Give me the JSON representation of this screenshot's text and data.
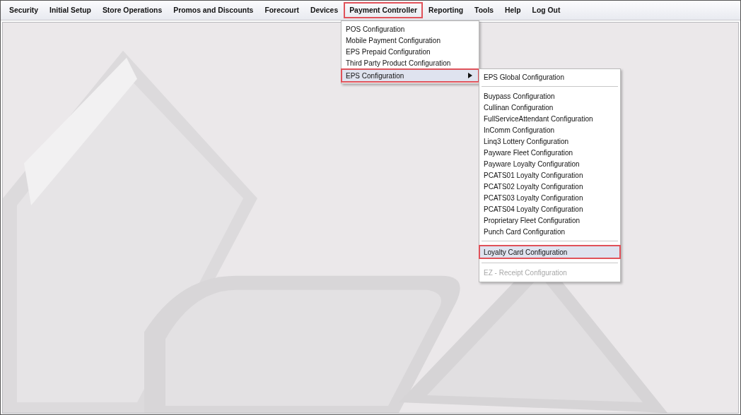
{
  "menu_bar": {
    "items": [
      {
        "label": "Security",
        "highlighted": false
      },
      {
        "label": "Initial Setup",
        "highlighted": false
      },
      {
        "label": "Store Operations",
        "highlighted": false
      },
      {
        "label": "Promos and Discounts",
        "highlighted": false
      },
      {
        "label": "Forecourt",
        "highlighted": false
      },
      {
        "label": "Devices",
        "highlighted": false
      },
      {
        "label": "Payment Controller",
        "highlighted": true
      },
      {
        "label": "Reporting",
        "highlighted": false
      },
      {
        "label": "Tools",
        "highlighted": false
      },
      {
        "label": "Help",
        "highlighted": false
      },
      {
        "label": "Log Out",
        "highlighted": false
      }
    ]
  },
  "dropdown_menu": {
    "items": [
      {
        "label": "POS Configuration",
        "kind": "item",
        "selected": false,
        "highlighted": false
      },
      {
        "label": "Mobile Payment Configuration",
        "kind": "item",
        "selected": false,
        "highlighted": false
      },
      {
        "label": "EPS Prepaid Configuration",
        "kind": "item",
        "selected": false,
        "highlighted": false
      },
      {
        "label": "Third Party Product Configuration",
        "kind": "item",
        "selected": false,
        "highlighted": false
      },
      {
        "label": "EPS Configuration",
        "kind": "submenu",
        "selected": true,
        "highlighted": true
      }
    ]
  },
  "submenu": {
    "sections": [
      {
        "items": [
          {
            "label": "EPS Global Configuration",
            "selected": false,
            "highlighted": false,
            "disabled": false
          }
        ]
      },
      {
        "items": [
          {
            "label": "Buypass Configuration",
            "selected": false,
            "highlighted": false,
            "disabled": false
          },
          {
            "label": "Cullinan Configuration",
            "selected": false,
            "highlighted": false,
            "disabled": false
          },
          {
            "label": "FullServiceAttendant Configuration",
            "selected": false,
            "highlighted": false,
            "disabled": false
          },
          {
            "label": "InComm Configuration",
            "selected": false,
            "highlighted": false,
            "disabled": false
          },
          {
            "label": "Linq3 Lottery Configuration",
            "selected": false,
            "highlighted": false,
            "disabled": false
          },
          {
            "label": "Payware Fleet Configuration",
            "selected": false,
            "highlighted": false,
            "disabled": false
          },
          {
            "label": "Payware Loyalty Configuration",
            "selected": false,
            "highlighted": false,
            "disabled": false
          },
          {
            "label": "PCATS01 Loyalty Configuration",
            "selected": false,
            "highlighted": false,
            "disabled": false
          },
          {
            "label": "PCATS02 Loyalty Configuration",
            "selected": false,
            "highlighted": false,
            "disabled": false
          },
          {
            "label": "PCATS03 Loyalty Configuration",
            "selected": false,
            "highlighted": false,
            "disabled": false
          },
          {
            "label": "PCATS04 Loyalty Configuration",
            "selected": false,
            "highlighted": false,
            "disabled": false
          },
          {
            "label": "Proprietary Fleet Configuration",
            "selected": false,
            "highlighted": false,
            "disabled": false
          },
          {
            "label": "Punch Card Configuration",
            "selected": false,
            "highlighted": false,
            "disabled": false
          }
        ]
      },
      {
        "items": [
          {
            "label": "Loyalty Card Configuration",
            "selected": true,
            "highlighted": true,
            "disabled": false
          }
        ]
      },
      {
        "items": [
          {
            "label": "EZ - Receipt Configuration",
            "selected": false,
            "highlighted": false,
            "disabled": true
          }
        ]
      }
    ]
  }
}
